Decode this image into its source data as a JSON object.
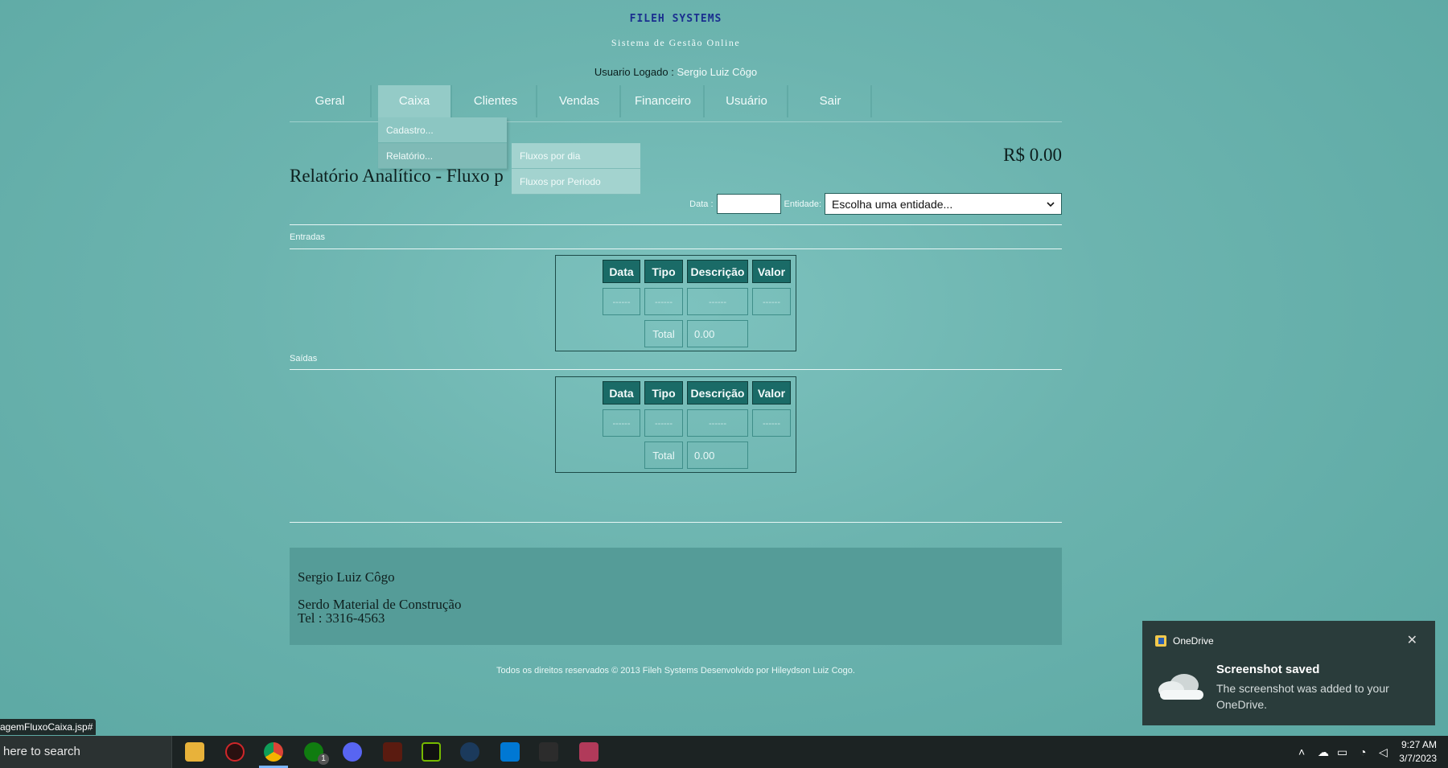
{
  "header": {
    "brand": "FILEH SYSTEMS",
    "tagline": "Sistema de Gestão Online",
    "user_label": "Usuario Logado : ",
    "user_name": "Sergio Luiz Côgo"
  },
  "nav": {
    "items": [
      "Geral",
      "Caixa",
      "Clientes",
      "Vendas",
      "Financeiro",
      "Usuário",
      "Sair"
    ],
    "active": "Caixa",
    "dropdown": [
      "Cadastro...",
      "Relatório..."
    ],
    "submenu": [
      "Fluxos por dia",
      "Fluxos por Periodo"
    ]
  },
  "report": {
    "title": "Relatório Analítico - Fluxo p",
    "total_amount": "R$ 0.00",
    "date_label": "Data :",
    "entity_label": "Entidade:",
    "entity_placeholder": "Escolha uma entidade..."
  },
  "entradas": {
    "label": "Entradas",
    "headers": [
      "Data",
      "Tipo",
      "Descrição",
      "Valor"
    ],
    "row": [
      "------",
      "------",
      "------",
      "------"
    ],
    "total_label": "Total",
    "total_value": "0.00"
  },
  "saidas": {
    "label": "Saídas",
    "headers": [
      "Data",
      "Tipo",
      "Descrição",
      "Valor"
    ],
    "row": [
      "------",
      "------",
      "------",
      "------"
    ],
    "total_label": "Total",
    "total_value": "0.00"
  },
  "footer": {
    "name": "Sergio Luiz Côgo",
    "company": "Serdo Material de Construção",
    "phone": "Tel : 3316-4563",
    "copyright": "Todos os direitos reservados © 2013 Fileh Systems Desenvolvido por Hileydson Luiz Cogo."
  },
  "status_bar": {
    "url": "agemFluxoCaixa.jsp#"
  },
  "toast": {
    "app": "OneDrive",
    "title": "Screenshot saved",
    "body": "The screenshot was added to your OneDrive."
  },
  "taskbar": {
    "search_text": "here to search",
    "xbox_badge": "1",
    "time": "9:27 AM",
    "date": "3/7/2023",
    "icons": [
      "file-explorer-icon",
      "app-red-icon",
      "chrome-icon",
      "xbox-icon",
      "discord-icon",
      "game-icon",
      "nvidia-icon",
      "steam-icon",
      "vscode-icon",
      "game-controller-icon",
      "app-pink-icon"
    ]
  }
}
